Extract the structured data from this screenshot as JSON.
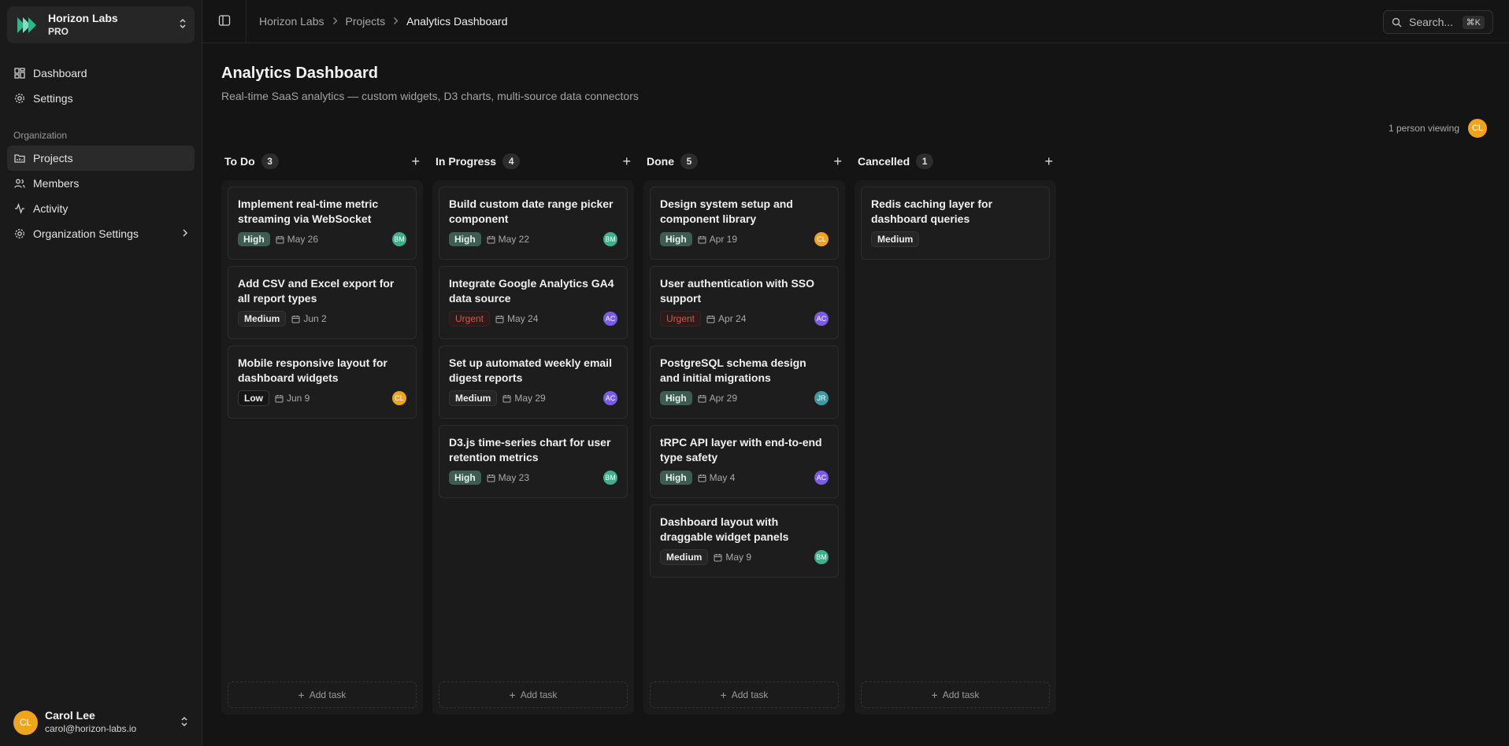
{
  "org": {
    "name": "Horizon Labs",
    "plan": "PRO"
  },
  "nav": {
    "primary": [
      {
        "label": "Dashboard",
        "icon": "dashboard-icon"
      },
      {
        "label": "Settings",
        "icon": "gear-icon"
      }
    ],
    "section_label": "Organization",
    "org_items": [
      {
        "label": "Projects",
        "icon": "folder-icon",
        "active": true
      },
      {
        "label": "Members",
        "icon": "users-icon"
      },
      {
        "label": "Activity",
        "icon": "activity-icon"
      },
      {
        "label": "Organization Settings",
        "icon": "gear-icon"
      }
    ]
  },
  "user": {
    "initials": "CL",
    "name": "Carol Lee",
    "email": "carol@horizon-labs.io"
  },
  "breadcrumb": [
    "Horizon Labs",
    "Projects",
    "Analytics Dashboard"
  ],
  "search": {
    "placeholder": "Search...",
    "shortcut": "⌘K"
  },
  "page": {
    "title": "Analytics Dashboard",
    "subtitle": "Real-time SaaS analytics — custom widgets, D3 charts, multi-source data connectors",
    "viewing": "1 person viewing",
    "viewer_initials": "CL"
  },
  "add_task_label": "Add task",
  "avatar_colors": {
    "BM": "#3fae8c",
    "AC": "#7b5ce6",
    "CL": "#f0a41c",
    "JR": "#3f9aa3"
  },
  "columns": [
    {
      "title": "To Do",
      "count": "3",
      "cards": [
        {
          "title": "Implement real-time metric streaming via WebSocket",
          "priority": "High",
          "date": "May 26",
          "assignee": "BM"
        },
        {
          "title": "Add CSV and Excel export for all report types",
          "priority": "Medium",
          "date": "Jun 2",
          "assignee": ""
        },
        {
          "title": "Mobile responsive layout for dashboard widgets",
          "priority": "Low",
          "date": "Jun 9",
          "assignee": "CL"
        }
      ]
    },
    {
      "title": "In Progress",
      "count": "4",
      "cards": [
        {
          "title": "Build custom date range picker component",
          "priority": "High",
          "date": "May 22",
          "assignee": "BM"
        },
        {
          "title": "Integrate Google Analytics GA4 data source",
          "priority": "Urgent",
          "date": "May 24",
          "assignee": "AC"
        },
        {
          "title": "Set up automated weekly email digest reports",
          "priority": "Medium",
          "date": "May 29",
          "assignee": "AC"
        },
        {
          "title": "D3.js time-series chart for user retention metrics",
          "priority": "High",
          "date": "May 23",
          "assignee": "BM"
        }
      ]
    },
    {
      "title": "Done",
      "count": "5",
      "cards": [
        {
          "title": "Design system setup and component library",
          "priority": "High",
          "date": "Apr 19",
          "assignee": "CL"
        },
        {
          "title": "User authentication with SSO support",
          "priority": "Urgent",
          "date": "Apr 24",
          "assignee": "AC"
        },
        {
          "title": "PostgreSQL schema design and initial migrations",
          "priority": "High",
          "date": "Apr 29",
          "assignee": "JR"
        },
        {
          "title": "tRPC API layer with end-to-end type safety",
          "priority": "High",
          "date": "May 4",
          "assignee": "AC"
        },
        {
          "title": "Dashboard layout with draggable widget panels",
          "priority": "Medium",
          "date": "May 9",
          "assignee": "BM"
        }
      ]
    },
    {
      "title": "Cancelled",
      "count": "1",
      "cards": [
        {
          "title": "Redis caching layer for dashboard queries",
          "priority": "Medium",
          "date": "",
          "assignee": ""
        }
      ]
    }
  ]
}
